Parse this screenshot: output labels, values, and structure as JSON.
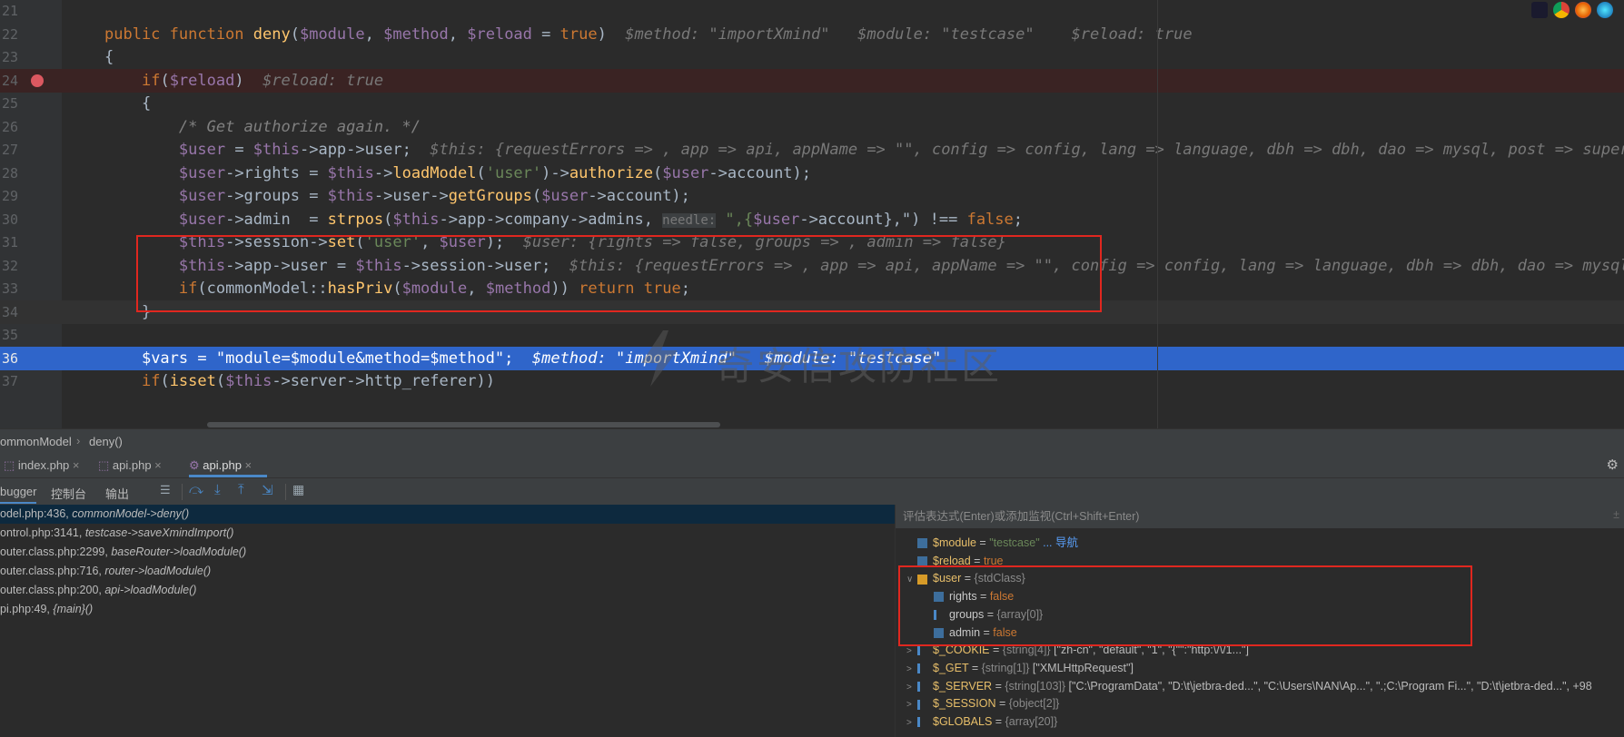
{
  "editor": {
    "lines": [
      {
        "num": "21",
        "type": "plain",
        "segments": [
          {
            "c": "tx",
            "t": "    "
          }
        ]
      },
      {
        "num": "22",
        "type": "plain",
        "segments": [
          {
            "c": "kw",
            "t": "public function "
          },
          {
            "c": "fn",
            "t": "deny"
          },
          {
            "c": "tx",
            "t": "("
          },
          {
            "c": "var",
            "t": "$module"
          },
          {
            "c": "tx",
            "t": ", "
          },
          {
            "c": "var",
            "t": "$method"
          },
          {
            "c": "tx",
            "t": ", "
          },
          {
            "c": "var",
            "t": "$reload"
          },
          {
            "c": "tx",
            "t": " = "
          },
          {
            "c": "kw",
            "t": "true"
          },
          {
            "c": "tx",
            "t": ")  "
          },
          {
            "c": "hint",
            "t": "$method: \"importXmind\"   $module: \"testcase\"    $reload: true"
          }
        ]
      },
      {
        "num": "23",
        "type": "plain",
        "segments": [
          {
            "c": "tx",
            "t": "{"
          }
        ]
      },
      {
        "num": "24",
        "type": "breakpoint",
        "segments": [
          {
            "c": "tx",
            "t": "    "
          },
          {
            "c": "kw",
            "t": "if"
          },
          {
            "c": "tx",
            "t": "("
          },
          {
            "c": "var",
            "t": "$reload"
          },
          {
            "c": "tx",
            "t": ")  "
          },
          {
            "c": "hint",
            "t": "$reload: true"
          }
        ]
      },
      {
        "num": "25",
        "type": "plain",
        "segments": [
          {
            "c": "tx",
            "t": "    {"
          }
        ]
      },
      {
        "num": "26",
        "type": "plain",
        "segments": [
          {
            "c": "tx",
            "t": "        "
          },
          {
            "c": "cm",
            "t": "/* Get authorize again. */"
          }
        ]
      },
      {
        "num": "27",
        "type": "plain",
        "segments": [
          {
            "c": "tx",
            "t": "        "
          },
          {
            "c": "var",
            "t": "$user"
          },
          {
            "c": "tx",
            "t": " = "
          },
          {
            "c": "var",
            "t": "$this"
          },
          {
            "c": "tx",
            "t": "->app->user;  "
          },
          {
            "c": "hint",
            "t": "$this: {requestErrors => , app => api, appName => \"\", config => config, lang => language, dbh => dbh, dao => mysql, post => super, g"
          }
        ]
      },
      {
        "num": "28",
        "type": "plain",
        "segments": [
          {
            "c": "tx",
            "t": "        "
          },
          {
            "c": "var",
            "t": "$user"
          },
          {
            "c": "tx",
            "t": "->rights = "
          },
          {
            "c": "var",
            "t": "$this"
          },
          {
            "c": "tx",
            "t": "->"
          },
          {
            "c": "fn",
            "t": "loadModel"
          },
          {
            "c": "tx",
            "t": "("
          },
          {
            "c": "str",
            "t": "'user'"
          },
          {
            "c": "tx",
            "t": ")->"
          },
          {
            "c": "fn",
            "t": "authorize"
          },
          {
            "c": "tx",
            "t": "("
          },
          {
            "c": "var",
            "t": "$user"
          },
          {
            "c": "tx",
            "t": "->account);"
          }
        ]
      },
      {
        "num": "29",
        "type": "plain",
        "segments": [
          {
            "c": "tx",
            "t": "        "
          },
          {
            "c": "var",
            "t": "$user"
          },
          {
            "c": "tx",
            "t": "->groups = "
          },
          {
            "c": "var",
            "t": "$this"
          },
          {
            "c": "tx",
            "t": "->user->"
          },
          {
            "c": "fn",
            "t": "getGroups"
          },
          {
            "c": "tx",
            "t": "("
          },
          {
            "c": "var",
            "t": "$user"
          },
          {
            "c": "tx",
            "t": "->account);"
          }
        ]
      },
      {
        "num": "30",
        "type": "plain",
        "segments": [
          {
            "c": "tx",
            "t": "        "
          },
          {
            "c": "var",
            "t": "$user"
          },
          {
            "c": "tx",
            "t": "->admin  = "
          },
          {
            "c": "fn",
            "t": "strpos"
          },
          {
            "c": "tx",
            "t": "("
          },
          {
            "c": "var",
            "t": "$this"
          },
          {
            "c": "tx",
            "t": "->app->company->admins, "
          },
          {
            "c": "tag",
            "t": "needle:"
          },
          {
            "c": "str",
            "t": " \",{"
          },
          {
            "c": "var",
            "t": "$user"
          },
          {
            "c": "tx",
            "t": "->account},\""
          },
          {
            "c": "tx",
            "t": ") !== "
          },
          {
            "c": "kw",
            "t": "false"
          },
          {
            "c": "tx",
            "t": ";"
          }
        ]
      },
      {
        "num": "31",
        "type": "plain",
        "segments": [
          {
            "c": "tx",
            "t": "        "
          },
          {
            "c": "var",
            "t": "$this"
          },
          {
            "c": "tx",
            "t": "->session->"
          },
          {
            "c": "fn",
            "t": "set"
          },
          {
            "c": "tx",
            "t": "("
          },
          {
            "c": "str",
            "t": "'user'"
          },
          {
            "c": "tx",
            "t": ", "
          },
          {
            "c": "var",
            "t": "$user"
          },
          {
            "c": "tx",
            "t": ");  "
          },
          {
            "c": "hint",
            "t": "$user: {rights => false, groups => , admin => false}"
          }
        ]
      },
      {
        "num": "32",
        "type": "plain",
        "segments": [
          {
            "c": "tx",
            "t": "        "
          },
          {
            "c": "var",
            "t": "$this"
          },
          {
            "c": "tx",
            "t": "->app->user = "
          },
          {
            "c": "var",
            "t": "$this"
          },
          {
            "c": "tx",
            "t": "->session->user;  "
          },
          {
            "c": "hint",
            "t": "$this: {requestErrors => , app => api, appName => \"\", config => config, lang => language, dbh => dbh, dao => mysql, p"
          }
        ]
      },
      {
        "num": "33",
        "type": "plain",
        "segments": [
          {
            "c": "tx",
            "t": "        "
          },
          {
            "c": "kw",
            "t": "if"
          },
          {
            "c": "tx",
            "t": "(commonModel::"
          },
          {
            "c": "fn",
            "t": "hasPriv"
          },
          {
            "c": "tx",
            "t": "("
          },
          {
            "c": "var",
            "t": "$module"
          },
          {
            "c": "tx",
            "t": ", "
          },
          {
            "c": "var",
            "t": "$method"
          },
          {
            "c": "tx",
            "t": ")) "
          },
          {
            "c": "kw",
            "t": "return true"
          },
          {
            "c": "tx",
            "t": ";"
          }
        ]
      },
      {
        "num": "34",
        "type": "current",
        "segments": [
          {
            "c": "tx",
            "t": "    }"
          }
        ]
      },
      {
        "num": "35",
        "type": "plain",
        "segments": [
          {
            "c": "tx",
            "t": ""
          }
        ]
      },
      {
        "num": "36",
        "type": "exec",
        "segments": [
          {
            "c": "tx",
            "t": "    "
          },
          {
            "c": "var",
            "t": "$vars"
          },
          {
            "c": "tx",
            "t": " = "
          },
          {
            "c": "str",
            "t": "\"module=$module&method=$method\""
          },
          {
            "c": "tx",
            "t": ";  "
          },
          {
            "c": "hint",
            "t": "$method: \"importXmind\"   $module: \"testcase\""
          }
        ]
      },
      {
        "num": "37",
        "type": "plain",
        "segments": [
          {
            "c": "tx",
            "t": "    "
          },
          {
            "c": "kw",
            "t": "if"
          },
          {
            "c": "tx",
            "t": "("
          },
          {
            "c": "fn",
            "t": "isset"
          },
          {
            "c": "tx",
            "t": "("
          },
          {
            "c": "var",
            "t": "$this"
          },
          {
            "c": "tx",
            "t": "->server->http_referer))"
          }
        ]
      }
    ],
    "watermark": "奇安信攻防社区"
  },
  "breadcrumb": {
    "class": "ommonModel",
    "method": "deny()"
  },
  "tabs": [
    {
      "label": "index.php",
      "active": false
    },
    {
      "label": "api.php",
      "active": false
    },
    {
      "label": "api.php",
      "active": true
    }
  ],
  "debugger": {
    "tab_debugger": "bugger",
    "tab_console": "控制台",
    "tab_output": "输出"
  },
  "frames": [
    {
      "loc": "odel.php:436, ",
      "call": "commonModel->deny()",
      "selected": true
    },
    {
      "loc": "ontrol.php:3141, ",
      "call": "testcase->saveXmindImport()",
      "selected": false
    },
    {
      "loc": "outer.class.php:2299, ",
      "call": "baseRouter->loadModule()",
      "selected": false
    },
    {
      "loc": "outer.class.php:716, ",
      "call": "router->loadModule()",
      "selected": false
    },
    {
      "loc": "outer.class.php:200, ",
      "call": "api->loadModule()",
      "selected": false
    },
    {
      "loc": "pi.php:49, ",
      "call": "{main}()",
      "selected": false
    }
  ],
  "eval_placeholder": "评估表达式(Enter)或添加监视(Ctrl+Shift+Enter)",
  "variables": [
    {
      "indent": 0,
      "arrow": "",
      "icon": "01",
      "name": "$module",
      "eq": " = ",
      "value": "\"testcase\"",
      "vclass": "vs",
      "extra": " ... 导航"
    },
    {
      "indent": 0,
      "arrow": "",
      "icon": "01",
      "name": "$reload",
      "eq": " = ",
      "value": "true",
      "vclass": "vb",
      "extra": ""
    },
    {
      "indent": 0,
      "arrow": "∨",
      "icon": "obj",
      "name": "$user",
      "eq": " = ",
      "value": "{stdClass}",
      "vclass": "vt",
      "extra": ""
    },
    {
      "indent": 1,
      "arrow": "",
      "icon": "01",
      "name": "rights",
      "eq": " = ",
      "value": "false",
      "vclass": "vb",
      "extra": ""
    },
    {
      "indent": 1,
      "arrow": "",
      "icon": "arr",
      "name": "groups",
      "eq": " = ",
      "value": "{array[0]}",
      "vclass": "vt",
      "extra": ""
    },
    {
      "indent": 1,
      "arrow": "",
      "icon": "01",
      "name": "admin",
      "eq": " = ",
      "value": "false",
      "vclass": "vb",
      "extra": ""
    },
    {
      "indent": 0,
      "arrow": ">",
      "icon": "arr",
      "name": "$_COOKIE",
      "eq": " = ",
      "value": "{string[4]}",
      "vclass": "vt",
      "extra": " [\"zh-cn\", \"default\", \"1\", \"{\"\":\"http:\\/\\/1...\"]"
    },
    {
      "indent": 0,
      "arrow": ">",
      "icon": "arr",
      "name": "$_GET",
      "eq": " = ",
      "value": "{string[1]}",
      "vclass": "vt",
      "extra": " [\"XMLHttpRequest\"]"
    },
    {
      "indent": 0,
      "arrow": ">",
      "icon": "arr",
      "name": "$_SERVER",
      "eq": " = ",
      "value": "{string[103]}",
      "vclass": "vt",
      "extra": " [\"C:\\ProgramData\", \"D:\\t\\jetbra-ded...\", \"C:\\Users\\NAN\\Ap...\", \".;C:\\Program Fi...\", \"D:\\t\\jetbra-ded...\", +98"
    },
    {
      "indent": 0,
      "arrow": ">",
      "icon": "arr",
      "name": "$_SESSION",
      "eq": " = ",
      "value": "{object[2]}",
      "vclass": "vt",
      "extra": ""
    },
    {
      "indent": 0,
      "arrow": ">",
      "icon": "arr",
      "name": "$GLOBALS",
      "eq": " = ",
      "value": "{array[20]}",
      "vclass": "vt",
      "extra": ""
    }
  ],
  "colors": {
    "highlight_box": "#e0271f",
    "exec_line": "#2f65ca",
    "breakpoint": "#db5860"
  }
}
